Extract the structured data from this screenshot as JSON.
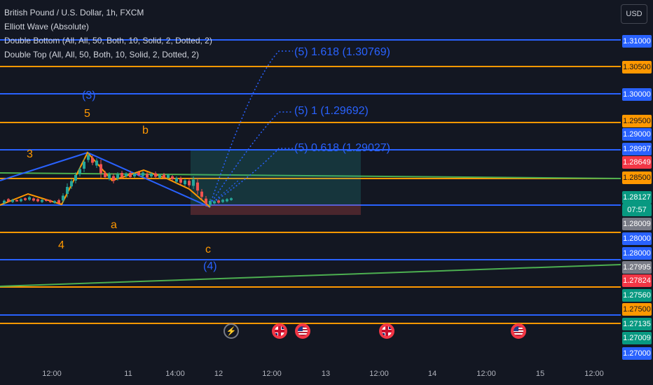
{
  "legend": {
    "symbol": "British Pound / U.S. Dollar, 1h, FXCM",
    "indicator1": "Elliott Wave (Absolute)",
    "indicator2": "Double Bottom (All, All, 50, Both, 10, Solid, 2, Dotted, 2)",
    "indicator3": "Double Top (All, All, 50, Both, 10, Solid, 2, Dotted, 2)"
  },
  "currency_button": "USD",
  "colors": {
    "background": "#131722",
    "blue_level": "#2962ff",
    "orange_level": "#ff9800",
    "green_trend": "#4caf50",
    "candle_up": "#26a69a",
    "candle_down": "#ef5350",
    "red_tag": "#f23645",
    "gray_tag": "#787b86"
  },
  "price_axis": {
    "tags": [
      {
        "text": "1.31000",
        "color": "blue"
      },
      {
        "text": "1.30500",
        "color": "orange"
      },
      {
        "text": "1.30000",
        "color": "blue"
      },
      {
        "text": "1.29500",
        "color": "orange"
      },
      {
        "text": "1.29000",
        "color": "blue"
      },
      {
        "text": "1.28997",
        "color": "blue"
      },
      {
        "text": "1.28649",
        "color": "red"
      },
      {
        "text": "1.28500",
        "color": "orange"
      },
      {
        "text": "1.28127",
        "color": "green"
      },
      {
        "text": "07:57",
        "color": "green"
      },
      {
        "text": "1.28009",
        "color": "gray"
      },
      {
        "text": "1.28000",
        "color": "blue"
      },
      {
        "text": "1.28000",
        "color": "blue"
      },
      {
        "text": "1.27995",
        "color": "gray"
      },
      {
        "text": "1.27824",
        "color": "red"
      },
      {
        "text": "1.27560",
        "color": "green"
      },
      {
        "text": "1.27500",
        "color": "orange"
      },
      {
        "text": "1.27135",
        "color": "green"
      },
      {
        "text": "1.27009",
        "color": "green"
      },
      {
        "text": "1.27000",
        "color": "blue"
      }
    ]
  },
  "wave_labels": {
    "wave_3_paren": "(3)",
    "wave_5": "5",
    "wave_b": "b",
    "wave_3": "3",
    "wave_a": "a",
    "wave_4": "4",
    "wave_c": "c",
    "wave_4_paren": "(4)"
  },
  "projections": [
    {
      "text": "(5) 1.618 (1.30769)"
    },
    {
      "text": "(5) 1 (1.29692)"
    },
    {
      "text": "(5) 0.618 (1.29027)"
    }
  ],
  "time_axis": [
    "12:00",
    "11",
    "14:00",
    "12",
    "12:00",
    "13",
    "12:00",
    "14",
    "12:00",
    "15",
    "12:00"
  ],
  "events": [
    {
      "icon": "lightning-icon",
      "type": "lightning"
    },
    {
      "icon": "flag-uk-icon",
      "type": "uk"
    },
    {
      "icon": "flag-us-icon",
      "type": "us"
    },
    {
      "icon": "flag-uk-icon",
      "type": "uk"
    },
    {
      "icon": "flag-us-icon",
      "type": "us"
    }
  ]
}
